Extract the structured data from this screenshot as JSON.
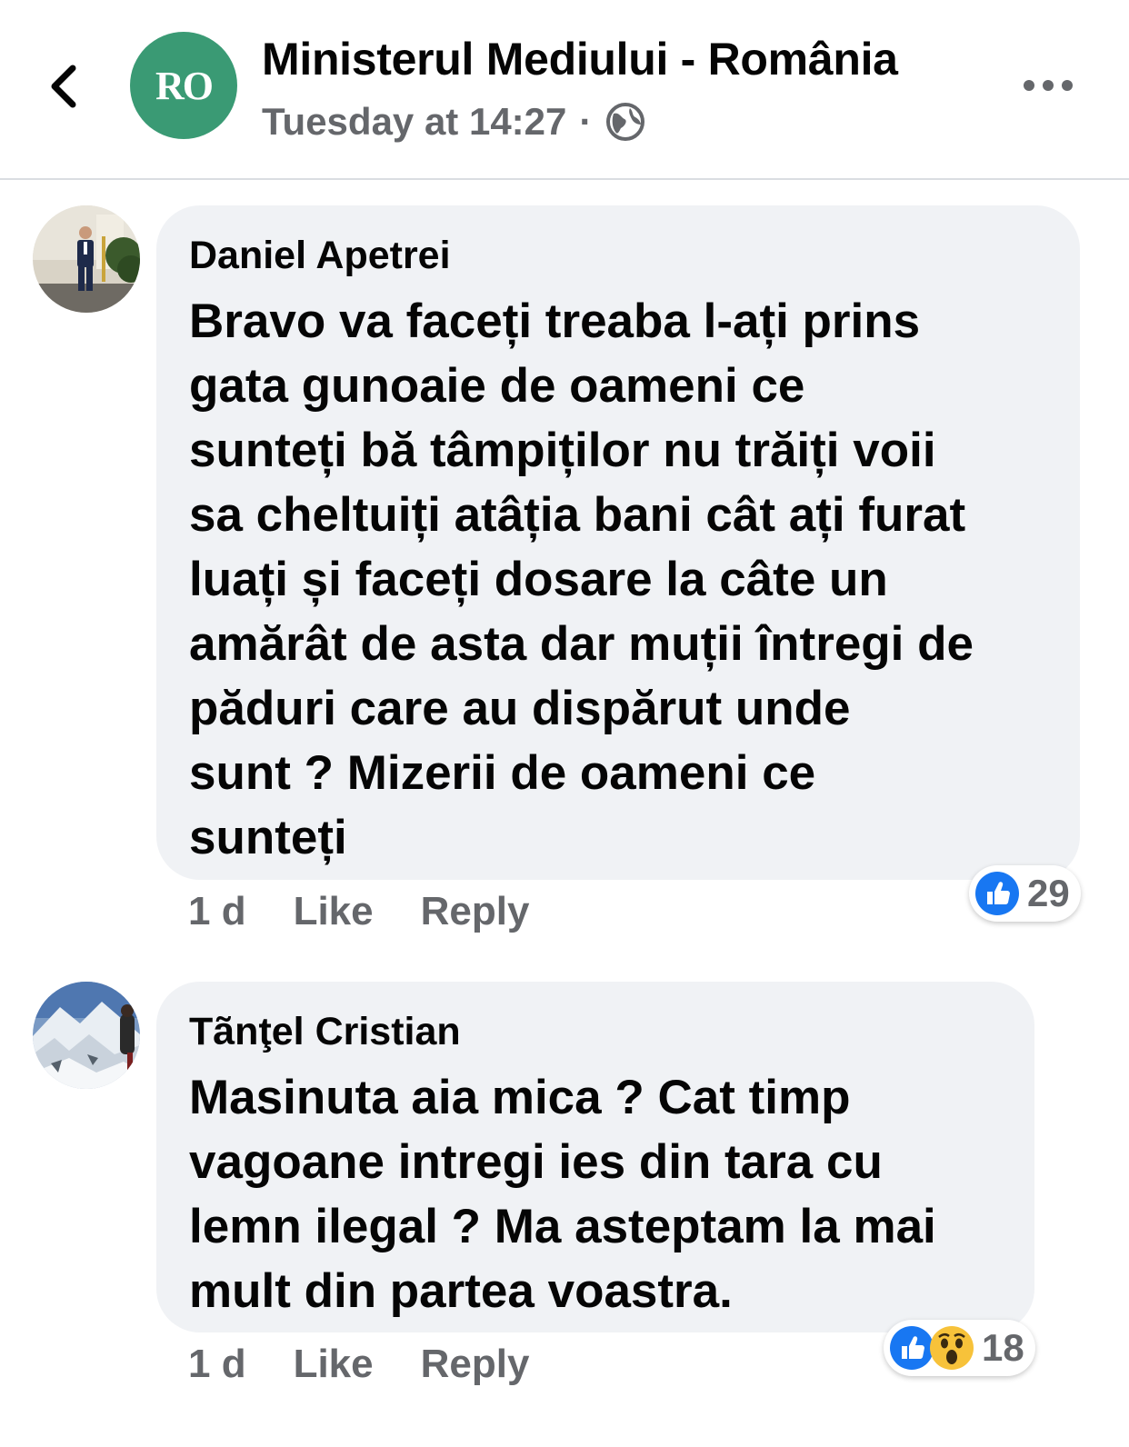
{
  "header": {
    "page_name": "Ministerul Mediului - România",
    "avatar_text": "RO",
    "timestamp": "Tuesday at 14:27",
    "separator": "·",
    "privacy_icon": "globe-icon",
    "back_icon": "chevron-left-icon",
    "more_icon": "more-dots-icon",
    "avatar_color": "#3a9a74"
  },
  "comments": [
    {
      "author": "Daniel Apetrei",
      "text": "Bravo va faceți treaba l-ați prins\ngata gunoaie de oameni ce\nsunteți bă tâmpiților nu trăiți voii\nsa cheltuiți atâția bani cât ați furat\nluați și faceți dosare la câte un\namărât de asta dar muții întregi de\npăduri care au dispărut unde\nsunt ? Mizerii de oameni ce\nsunteți",
      "time": "1 d",
      "like_label": "Like",
      "reply_label": "Reply",
      "reactions": [
        "like"
      ],
      "reaction_count": "29"
    },
    {
      "author": "Tãnţel Cristian",
      "text": "Masinuta aia mica ? Cat timp\nvagoane intregi ies din tara cu\nlemn ilegal ? Ma asteptam la mai\nmult din partea voastra.",
      "time": "1 d",
      "like_label": "Like",
      "reply_label": "Reply",
      "reactions": [
        "like",
        "wow"
      ],
      "reaction_count": "18"
    }
  ],
  "colors": {
    "like_blue": "#1877f2",
    "bubble_bg": "#f0f2f5",
    "secondary_text": "#65676b"
  }
}
